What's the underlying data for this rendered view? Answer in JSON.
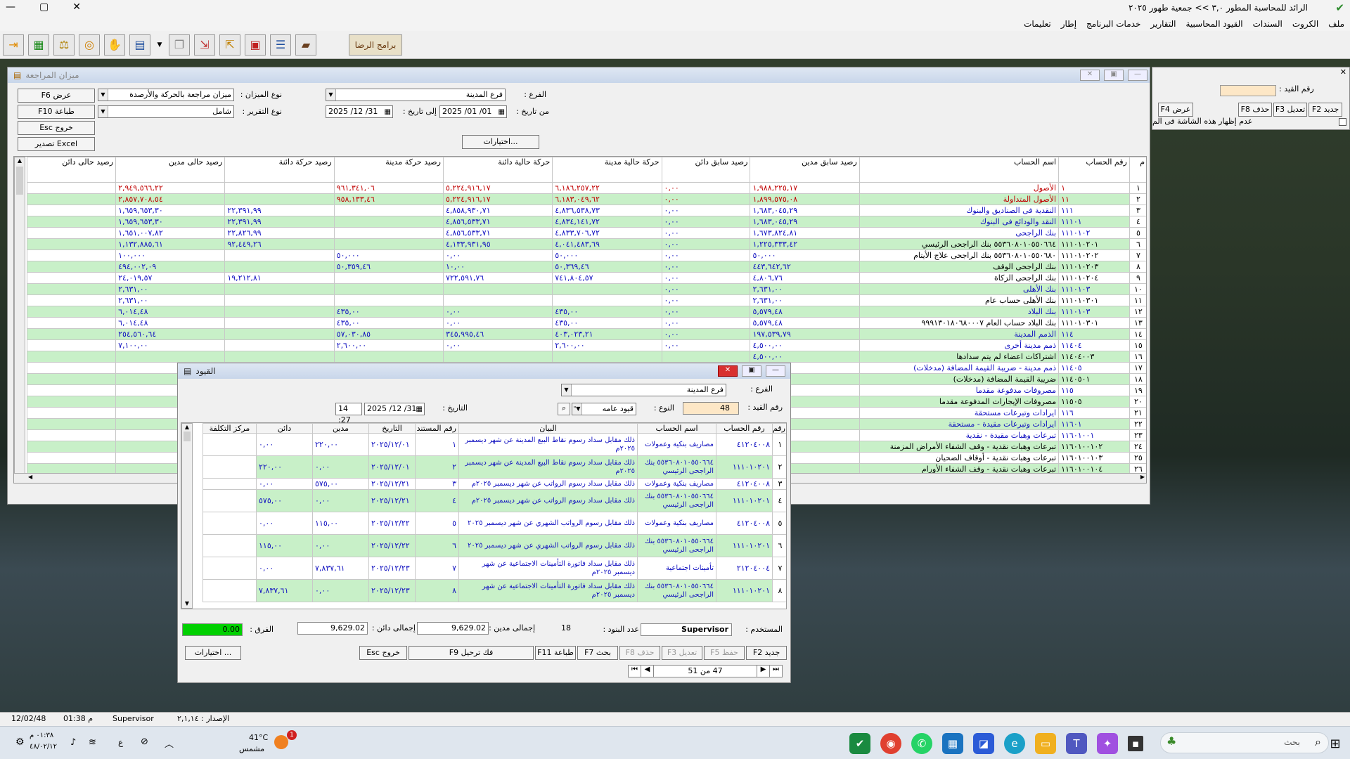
{
  "app": {
    "title": "الرائد للمحاسبة المطور ٣,٠ >> جمعية طهور ٢٠٢٥",
    "minimize": "—",
    "maximize": "▢",
    "close": "✕"
  },
  "menu": [
    "ملف",
    "الكروت",
    "السندات",
    "القيود المحاسبية",
    "التقارير",
    "خدمات البرنامج",
    "إطار",
    "تعليمات"
  ],
  "toolbar": {
    "logo_text": "برامج الرضا"
  },
  "trial": {
    "title": "ميزان المراجعة",
    "btn_view": "F6 عرض",
    "btn_print": "F10 طباعة",
    "btn_exit": "Esc خروج",
    "btn_excel": "تصدير Excel",
    "lbl_type": "نوع الميزان :",
    "type_value": "ميزان مراجعة بالحركة والأرصدة",
    "lbl_report": "نوع التقرير :",
    "report_value": "شامل",
    "lbl_branch": "الفرع :",
    "branch_value": "فرع المدينة",
    "lbl_from": "من تاريخ :",
    "from_value": "2025 /01 /01",
    "lbl_to": "إلى تاريخ :",
    "to_value": "2025 /12 /31",
    "btn_options": "اختيارات...",
    "headers": [
      "م",
      "رقم الحساب",
      "اسم الحساب",
      "رصيد سابق مدين",
      "رصيد سابق دائن",
      "حركة حالية مدينة",
      "حركة حالية دائنة",
      "رصيد حركة مدينة",
      "رصيد حركة دائنة",
      "رصيد حالى مدين",
      "رصيد حالى دائن"
    ],
    "rows": [
      [
        "١",
        "١",
        "الأصول",
        "١,٩٨٨,٢٢٥,١٧",
        "٠,٠٠",
        "٦,١٨٦,٢٥٧,٢٢",
        "٥,٢٢٤,٩١٦,١٧",
        "٩٦١,٣٤١,٠٦",
        "",
        "٢,٩٤٩,٥٦٦,٢٢",
        ""
      ],
      [
        "٢",
        "١١",
        "الأصول المتداولة",
        "١,٨٩٩,٥٧٥,٠٨",
        "٠,٠٠",
        "٦,١٨٣,٠٤٩,٦٢",
        "٥,٢٢٤,٩١٦,١٧",
        "٩٥٨,١٣٣,٤٦",
        "",
        "٢,٨٥٧,٧٠٨,٥٤",
        ""
      ],
      [
        "٣",
        "١١١",
        "النقدية فى الصناديق والبنوك",
        "١,٦٨٣,٠٤٥,٢٩",
        "٠,٠٠",
        "٤,٨٣٦,٥٣٨,٧٣",
        "٤,٨٥٨,٩٣٠,٧١",
        "",
        "٢٢,٣٩١,٩٩",
        "١,٦٥٩,٦٥٣,٣٠",
        ""
      ],
      [
        "٤",
        "١١١٠١",
        "النقد والودائع فى البنوك",
        "١,٦٨٣,٠٤٥,٢٩",
        "٠,٠٠",
        "٤,٨٣٤,١٤١,٧٢",
        "٤,٨٥٦,٥٣٣,٧١",
        "",
        "٢٢,٣٩١,٩٩",
        "١,٦٥٩,٦٥٣,٣٠",
        ""
      ],
      [
        "٥",
        "١١١٠١٠٢",
        "بنك الراجحى",
        "١,٦٧٣,٨٢٤,٨١",
        "٠,٠٠",
        "٤,٨٣٣,٧٠٦,٧٢",
        "٤,٨٥٦,٥٣٣,٧١",
        "",
        "٢٢,٨٢٦,٩٩",
        "١,٦٥١,٠٠٧,٨٢",
        ""
      ],
      [
        "٦",
        "١١١٠١٠٢٠١",
        "٥٥٣٦٠٨٠١٠٥٥٠٦٦٤ بنك الراجحى الرئيسي",
        "١,٢٢٥,٣٣٣,٤٢",
        "٠,٠٠",
        "٤,٠٤١,٤٨٣,٦٩",
        "٤,١٣٣,٩٣١,٩٥",
        "",
        "٩٢,٤٤٩,٢٦",
        "١,١٣٢,٨٨٥,٦١",
        ""
      ],
      [
        "٧",
        "١١١٠١٠٢٠٢",
        "٥٥٣٦٠٨٠١٠٥٥٠٦٨٠ بنك الراجحى علاج الأيتام",
        "٥٠,٠٠٠",
        "٠,٠٠",
        "٥٠,٠٠٠",
        "٠,٠٠",
        "٥٠,٠٠٠",
        "",
        "١٠٠,٠٠٠",
        ""
      ],
      [
        "٨",
        "١١١٠١٠٢٠٣",
        "بنك الراجحى الوقف",
        "٤٤٣,٦٤٢,٦٢",
        "٠,٠٠",
        "٥٠,٣٦٩,٤٦",
        "١٠,٠٠",
        "٥٠,٣٥٩,٤٦",
        "",
        "٤٩٤,٠٠٢,٠٩",
        ""
      ],
      [
        "٩",
        "١١١٠١٠٢٠٤",
        "بنك الراجحى الزكاة",
        "٤,٨٠٦,٧٦",
        "٠,٠٠",
        "٧٤١,٨٠٤,٥٧",
        "٧٢٢,٥٩١,٧٦",
        "",
        "١٩,٢١٢,٨١",
        "٢٤,٠١٩,٥٧",
        ""
      ],
      [
        "١٠",
        "١١١٠١٠٣",
        "بنك الأهلى",
        "٢,٦٣١,٠٠",
        "٠,٠٠",
        "",
        "",
        "",
        "",
        "٢,٦٣١,٠٠",
        ""
      ],
      [
        "١١",
        "١١١٠١٠٣٠١",
        "بنك الأهلى حساب عام",
        "٢,٦٣١,٠٠",
        "٠,٠٠",
        "",
        "",
        "",
        "",
        "٢,٦٣١,٠٠",
        ""
      ],
      [
        "١٢",
        "١١١٠١٠٣",
        "بنك البلاد",
        "٥,٥٧٩,٤٨",
        "٠,٠٠",
        "٤٣٥,٠٠",
        "٠,٠٠",
        "٤٣٥,٠٠",
        "",
        "٦,٠١٤,٤٨",
        ""
      ],
      [
        "١٣",
        "١١١٠١٠٣٠١",
        "بنك البلاد حساب العام ٩٩٩١٣٠١٨٠٦٨٠٠٠٧",
        "٥,٥٧٩,٤٨",
        "٠,٠٠",
        "٤٣٥,٠٠",
        "٠,٠٠",
        "٤٣٥,٠٠",
        "",
        "٦,٠١٤,٤٨",
        ""
      ],
      [
        "١٤",
        "١١٤",
        "الذمم المدينة",
        "١٩٧,٥٣٩,٧٩",
        "٠,٠٠",
        "٤٠٣,٠٢٣,٢١",
        "٣٤٥,٩٩٥,٤٦",
        "٥٧,٠٣٠,٨٥",
        "",
        "٢٥٤,٥٦٠,٦٤",
        ""
      ],
      [
        "١٥",
        "١١٤٠٤",
        "ذمم مدينة أخرى",
        "٤,٥٠٠,٠٠",
        "٠,٠٠",
        "٢,٦٠٠,٠٠",
        "٠,٠٠",
        "٢,٦٠٠,٠٠",
        "",
        "٧,١٠٠,٠٠",
        ""
      ],
      [
        "١٦",
        "١١٤٠٤٠٠٣",
        "اشتراكات اعضاء لم يتم سدادها",
        "٤,٥٠٠,٠٠",
        "",
        "",
        "",
        "",
        "",
        "",
        ""
      ],
      [
        "١٧",
        "١١٤٠٥",
        "ذمم مدينة - ضريبة القيمة المضافة (مدخلات)",
        "١٩٣,٠٣٩,٧٩",
        "",
        "",
        "",
        "",
        "",
        "",
        ""
      ],
      [
        "١٨",
        "١١٤٠٥٠١",
        "ضريبة القيمة المضافة (مدخلات)",
        "١٩٣,٠٣٩,٧٩",
        "",
        "",
        "",
        "",
        "",
        "",
        ""
      ],
      [
        "١٩",
        "١١٥",
        "مصروفات مدفوعة مقدما",
        "٢٠,٠٠٠,٠٠",
        "",
        "",
        "",
        "",
        "",
        "",
        ""
      ],
      [
        "٢٠",
        "١١٥٠٥",
        "مصروفات الإيجارات المدفوعة مقدما",
        "٢٠,٠٠٠,٠٠",
        "",
        "",
        "",
        "",
        "",
        "",
        ""
      ],
      [
        "٢١",
        "١١٦",
        "ايرادات وتبرعات مستحقة",
        "",
        "",
        "",
        "",
        "",
        "",
        "",
        ""
      ],
      [
        "٢٢",
        "١١٦٠١",
        "ايرادات وتبرعات مقيدة - مستحقة",
        "",
        "",
        "",
        "",
        "",
        "",
        "",
        ""
      ],
      [
        "٢٣",
        "١١٦٠١٠٠١",
        "تبرعات وهبات مقيدة - نقدية",
        "",
        "",
        "",
        "",
        "",
        "",
        "",
        ""
      ],
      [
        "٢٤",
        "١١٦٠١٠٠١٠٢",
        "تبرعات وهبات نقدية - وقف الشفاء الأمراض المزمنة",
        "",
        "",
        "",
        "",
        "",
        "",
        "",
        ""
      ],
      [
        "٢٥",
        "١١٦٠١٠٠١٠٣",
        "تبرعات وهبات نقدية - أوقاف الضحيان",
        "",
        "",
        "",
        "",
        "",
        "",
        "",
        ""
      ],
      [
        "٢٦",
        "١١٦٠١٠٠١٠٤",
        "تبرعات وهبات نقدية - وقف الشفاء الأورام",
        "",
        "",
        "",
        "",
        "",
        "",
        "",
        ""
      ]
    ]
  },
  "right_panel": {
    "lbl_entry_no": "رقم القيد :",
    "btn_new": "F2 جديد",
    "btn_edit": "F3 تعديل",
    "btn_delete": "F8 حذف",
    "btn_view": "F4 عرض",
    "chk_label": "عدم إظهار هذه الشاشة فى الم"
  },
  "entries": {
    "title": "القيود",
    "lbl_branch": "الفرع :",
    "branch_value": "فرع المدينة",
    "lbl_entry_no": "رقم القيد :",
    "entry_no": "48",
    "lbl_type": "النوع :",
    "type_value": "قيود عامه",
    "lbl_date": "التاريخ :",
    "date_value": "2025 /12 /31",
    "time_value": "14 :27",
    "headers": [
      "رقم",
      "رقم الحساب",
      "اسم الحساب",
      "البيان",
      "رقم المستند",
      "التاريخ",
      "مدين",
      "دائن",
      "مركز التكلفة"
    ],
    "rows": [
      [
        "١",
        "٤١٢٠٤٠٠٨",
        "مصاريف بنكية وعمولات",
        "ذلك مقابل سداد رسوم نقاط البيع المدينة عن شهر ديسمبر ٢٠٢٥م",
        "١",
        "٢٠٢٥/١٢/٠١",
        "٢٢٠,٠٠",
        "٠,٠٠",
        ""
      ],
      [
        "٢",
        "١١١٠١٠٢٠١",
        "٥٥٣٦٠٨٠١٠٥٥٠٦٦٤ بنك الراجحى الرئيسي",
        "ذلك مقابل سداد رسوم نقاط البيع المدينة عن شهر ديسمبر ٢٠٢٥م",
        "٢",
        "٢٠٢٥/١٢/٠١",
        "٠,٠٠",
        "٢٢٠,٠٠",
        ""
      ],
      [
        "٣",
        "٤١٢٠٤٠٠٨",
        "مصاريف بنكية وعمولات",
        "ذلك مقابل سداد رسوم الرواتب عن شهر ديسمبر ٢٠٢٥م",
        "٣",
        "٢٠٢٥/١٢/٢١",
        "٥٧٥,٠٠",
        "٠,٠٠",
        ""
      ],
      [
        "٤",
        "١١١٠١٠٢٠١",
        "٥٥٣٦٠٨٠١٠٥٥٠٦٦٤ بنك الراجحى الرئيسي",
        "ذلك مقابل سداد رسوم الرواتب عن شهر ديسمبر ٢٠٢٥م",
        "٤",
        "٢٠٢٥/١٢/٢١",
        "٠,٠٠",
        "٥٧٥,٠٠",
        ""
      ],
      [
        "٥",
        "٤١٢٠٤٠٠٨",
        "مصاريف بنكية وعمولات",
        "ذلك مقابل رسوم الرواتب الشهري عن شهر ديسمبر ٢٠٢٥",
        "٥",
        "٢٠٢٥/١٢/٢٢",
        "١١٥,٠٠",
        "٠,٠٠",
        ""
      ],
      [
        "٦",
        "١١١٠١٠٢٠١",
        "٥٥٣٦٠٨٠١٠٥٥٠٦٦٤ بنك الراجحى الرئيسي",
        "ذلك مقابل رسوم الرواتب الشهري عن شهر ديسمبر ٢٠٢٥",
        "٦",
        "٢٠٢٥/١٢/٢٢",
        "٠,٠٠",
        "١١٥,٠٠",
        ""
      ],
      [
        "٧",
        "٢١٢٠٤٠٠٤",
        "تأمينات اجتماعية",
        "ذلك مقابل سداد فاتورة التأمينات الاجتماعية عن شهر ديسمبر ٢٠٢٥م",
        "٧",
        "٢٠٢٥/١٢/٢٣",
        "٧,٨٣٧,٦١",
        "٠,٠٠",
        ""
      ],
      [
        "٨",
        "١١١٠١٠٢٠١",
        "٥٥٣٦٠٨٠١٠٥٥٠٦٦٤ بنك الراجحى الرئيسي",
        "ذلك مقابل سداد فاتورة التأمينات الاجتماعية عن شهر ديسمبر ٢٠٢٥م",
        "٨",
        "٢٠٢٥/١٢/٢٣",
        "٠,٠٠",
        "٧,٨٣٧,٦١",
        ""
      ]
    ],
    "lbl_user": "المستخدم :",
    "user_value": "Supervisor",
    "lbl_items": "عدد البنود :",
    "items_value": "18",
    "lbl_total_debit": "إجمالى مدين :",
    "total_debit": "9,629.02",
    "lbl_total_credit": "إجمالى دائن :",
    "total_credit": "9,629.02",
    "lbl_diff": "الفرق :",
    "diff_value": "0.00",
    "btn_new": "F2 جديد",
    "btn_save": "F5 حفظ",
    "btn_edit": "F3 تعديل",
    "btn_delete": "F8 حذف",
    "btn_search": "F7 بحث",
    "btn_print": "F11 طباعة",
    "btn_unpost": "F9 فك ترحيل",
    "btn_exit": "Esc خروج",
    "btn_options": "اختيارات ...",
    "nav_text": "47 من 51"
  },
  "status": {
    "date": "12/02/48",
    "time": "01:38 م",
    "user": "Supervisor",
    "version": "الإصدار : ٢,١,١٤"
  },
  "taskbar": {
    "weather_temp": "41°C",
    "weather_desc": "مشمس",
    "search_placeholder": "بحث",
    "clock_time": "٠١:٣٨ م",
    "clock_date": "٤٨/٠٢/١٢",
    "lang": "ع",
    "badge": "1"
  },
  "colors": {
    "grid_green": "#c8f0c8",
    "text_red": "#c00000",
    "text_blue": "#1010c0",
    "diff_green": "#00d000"
  }
}
